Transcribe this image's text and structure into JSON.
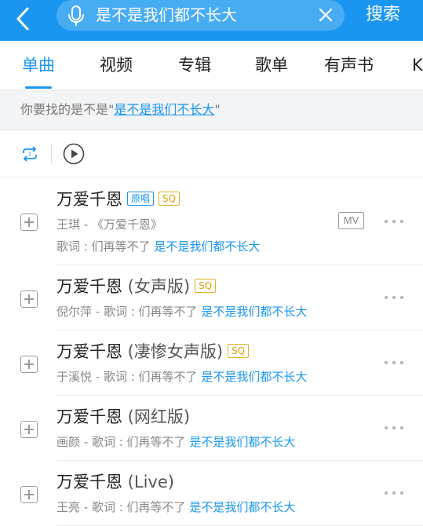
{
  "header": {
    "search_query": "是不是我们都不长大",
    "search_button": "搜索"
  },
  "tabs": [
    "单曲",
    "视频",
    "专辑",
    "歌单",
    "有声书",
    "K"
  ],
  "suggestion": {
    "prefix": "你要找的是不是\"",
    "query": "是不是我们不长大",
    "suffix": "\""
  },
  "songs": [
    {
      "title": "万爱千恩",
      "version": "",
      "tags": [
        "原唱",
        "SQ"
      ],
      "artist_line": "王琪 - 《万爱千恩》",
      "lyric_prefix": "歌词 : 们再等不了 ",
      "lyric_hl": "是不是我们都不长大",
      "mv": "MV"
    },
    {
      "title": "万爱千恩",
      "version": " (女声版)",
      "tags": [
        "SQ"
      ],
      "artist_line": "倪尔萍 - 歌词 : 们再等不了 ",
      "lyric_hl": "是不是我们都不长大"
    },
    {
      "title": "万爱千恩",
      "version": " (凄惨女声版)",
      "tags": [
        "SQ"
      ],
      "artist_line": "于溪悦 - 歌词 : 们再等不了 ",
      "lyric_hl": "是不是我们都不长大"
    },
    {
      "title": "万爱千恩",
      "version": " (网红版)",
      "tags": [],
      "artist_line": "画颜 - 歌词 : 们再等不了 ",
      "lyric_hl": "是不是我们都不长大"
    },
    {
      "title": "万爱千恩",
      "version": " (Live)",
      "tags": [],
      "artist_line": "王亮 - 歌词 : 们再等不了 ",
      "lyric_hl": "是不是我们都不长大"
    }
  ],
  "colors": {
    "brand": "#1a96f0",
    "sq": "#d9a20a"
  }
}
